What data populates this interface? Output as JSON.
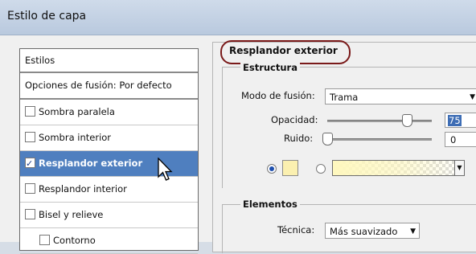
{
  "window": {
    "title": "Estilo de capa"
  },
  "styles_panel": {
    "header": "Estilos",
    "items": [
      {
        "label": "Opciones de fusión: Por defecto",
        "checkbox": false,
        "checked": false,
        "selected": false
      },
      {
        "label": "Sombra paralela",
        "checkbox": true,
        "checked": false,
        "selected": false
      },
      {
        "label": "Sombra interior",
        "checkbox": true,
        "checked": false,
        "selected": false
      },
      {
        "label": "Resplandor exterior",
        "checkbox": true,
        "checked": true,
        "selected": true
      },
      {
        "label": "Resplandor interior",
        "checkbox": true,
        "checked": false,
        "selected": false
      },
      {
        "label": "Bisel y relieve",
        "checkbox": true,
        "checked": false,
        "selected": false
      },
      {
        "label": "Contorno",
        "checkbox": true,
        "checked": false,
        "selected": false
      }
    ]
  },
  "settings": {
    "section_title": "Resplandor exterior",
    "estructura": {
      "title": "Estructura",
      "blend_mode_label": "Modo de fusión:",
      "blend_mode_value": "Trama",
      "opacity_label": "Opacidad:",
      "opacity_value": "75",
      "noise_label": "Ruido:",
      "noise_value": "0",
      "color_swatch": "#fbf0b0",
      "selected_fill": "solid-color"
    },
    "elementos": {
      "title": "Elementos",
      "technique_label": "Técnica:",
      "technique_value": "Más suavizado"
    }
  },
  "icons": {
    "cursor": "arrow-cursor-icon",
    "dropdown": "chevron-down-icon"
  },
  "colors": {
    "selection": "#4f7fbf",
    "titlebar": "#c4d3e6",
    "highlight_oval": "#7a1a1a"
  }
}
